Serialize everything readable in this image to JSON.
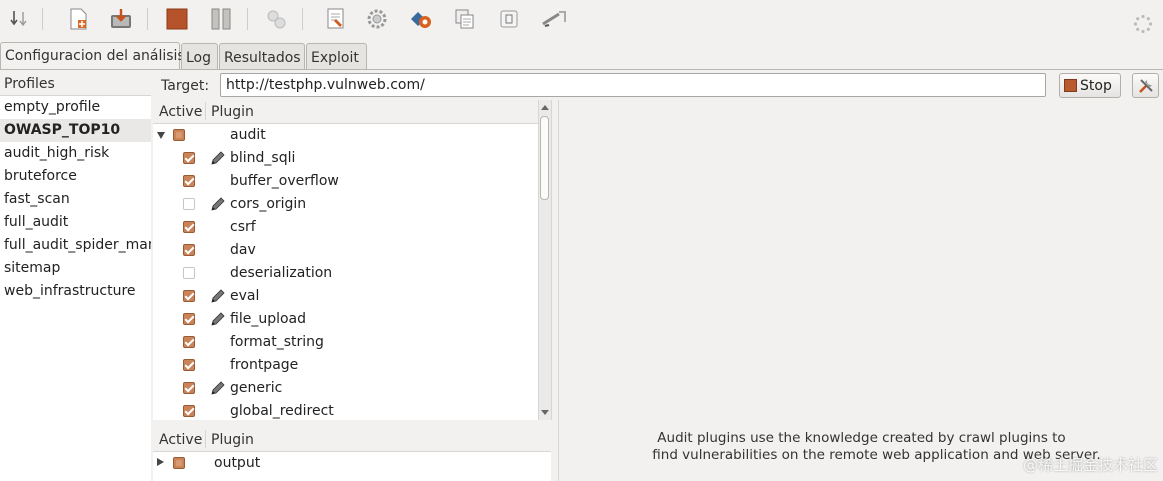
{
  "toolbar": {
    "icons": [
      "sort-down-icon",
      "new-profile-icon",
      "save-profile-icon",
      "stop-icon",
      "pause-icon",
      "wizard-icon",
      "report-icon",
      "config-icon",
      "proxy-icon",
      "compare-icon",
      "encode-icon",
      "fuzzy-request-icon",
      "throbber-icon"
    ]
  },
  "tabs": [
    {
      "label": "Configuracion del análisis",
      "active": true
    },
    {
      "label": "Log",
      "active": false
    },
    {
      "label": "Resultados",
      "active": false
    },
    {
      "label": "Exploit",
      "active": false
    }
  ],
  "profiles": {
    "header": "Profiles",
    "items": [
      {
        "label": "empty_profile",
        "selected": false
      },
      {
        "label": "OWASP_TOP10",
        "selected": true
      },
      {
        "label": "audit_high_risk",
        "selected": false
      },
      {
        "label": "bruteforce",
        "selected": false
      },
      {
        "label": "fast_scan",
        "selected": false
      },
      {
        "label": "full_audit",
        "selected": false
      },
      {
        "label": "full_audit_spider_man",
        "selected": false
      },
      {
        "label": "sitemap",
        "selected": false
      },
      {
        "label": "web_infrastructure",
        "selected": false
      }
    ]
  },
  "target": {
    "label": "Target:",
    "value": "http://testphp.vulnweb.com/",
    "stop_label": "Stop"
  },
  "plugins": {
    "header_active": "Active",
    "header_plugin": "Plugin",
    "group": {
      "name": "audit",
      "state": "partial",
      "expanded": true
    },
    "items": [
      {
        "name": "blind_sqli",
        "checked": true,
        "configurable": true
      },
      {
        "name": "buffer_overflow",
        "checked": true,
        "configurable": false
      },
      {
        "name": "cors_origin",
        "checked": false,
        "configurable": true
      },
      {
        "name": "csrf",
        "checked": true,
        "configurable": false
      },
      {
        "name": "dav",
        "checked": true,
        "configurable": false
      },
      {
        "name": "deserialization",
        "checked": false,
        "configurable": false
      },
      {
        "name": "eval",
        "checked": true,
        "configurable": true
      },
      {
        "name": "file_upload",
        "checked": true,
        "configurable": true
      },
      {
        "name": "format_string",
        "checked": true,
        "configurable": false
      },
      {
        "name": "frontpage",
        "checked": true,
        "configurable": false
      },
      {
        "name": "generic",
        "checked": true,
        "configurable": true
      },
      {
        "name": "global_redirect",
        "checked": true,
        "configurable": false
      }
    ]
  },
  "output": {
    "header_active": "Active",
    "header_plugin": "Plugin",
    "group": {
      "name": "output",
      "state": "partial",
      "expanded": false
    }
  },
  "info": {
    "line1": "Audit plugins use the knowledge created by crawl plugins to",
    "line2": "find vulnerabilities on the remote web application and web server."
  },
  "watermark": "@稀土掘金技术社区",
  "colors": {
    "accent": "#c9845a",
    "stop": "#b85a2e",
    "background": "#f2f1f0"
  }
}
